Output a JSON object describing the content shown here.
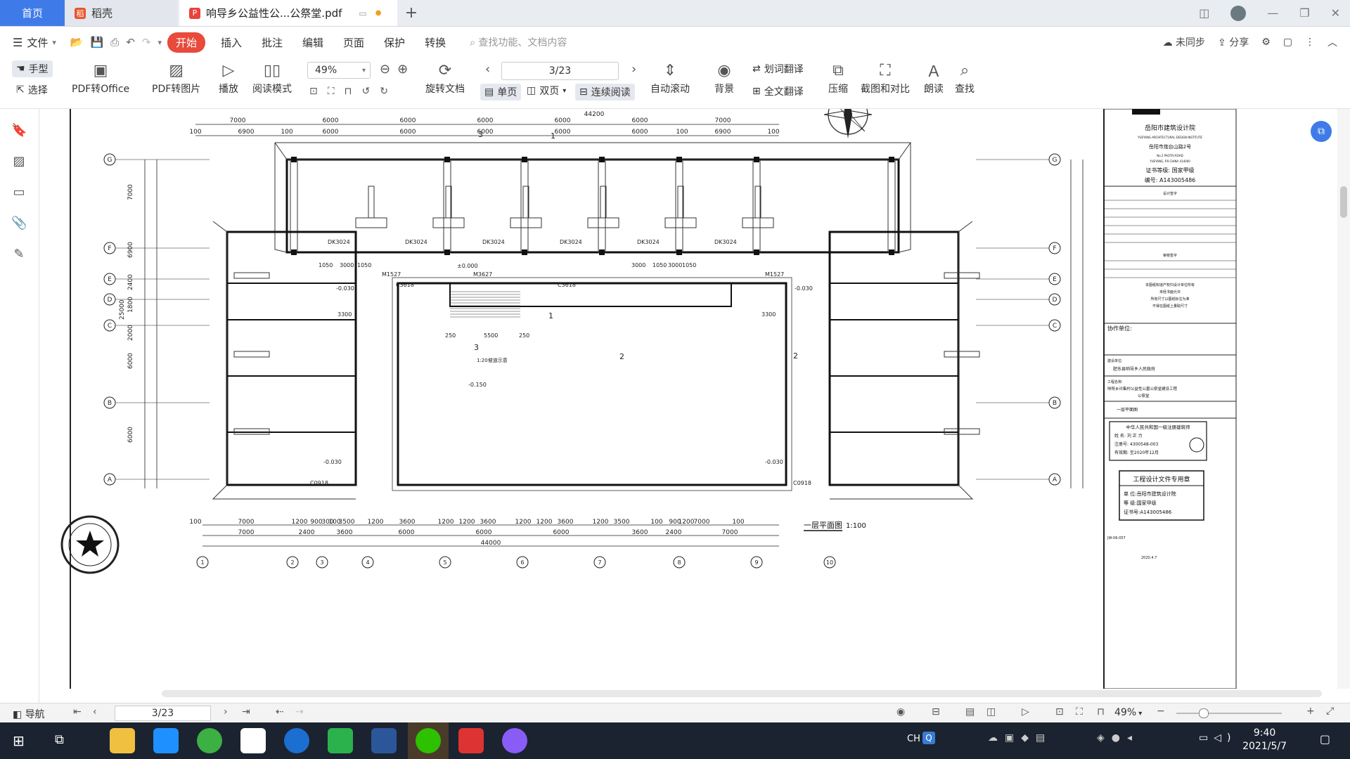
{
  "tabs": {
    "home": "首页",
    "daoke": "稻壳",
    "doc": "响导乡公益性公...公祭堂.pdf"
  },
  "menu": {
    "file": "文件",
    "start": "开始",
    "items": [
      "插入",
      "批注",
      "编辑",
      "页面",
      "保护",
      "转换"
    ],
    "search_placeholder": "查找功能、文档内容",
    "sync": "未同步",
    "share": "分享"
  },
  "toolbar": {
    "hand": "手型",
    "select": "选择",
    "pdf_to_office": "PDF转Office",
    "pdf_to_image": "PDF转图片",
    "play": "播放",
    "read_mode": "阅读模式",
    "zoom": "49%",
    "page": "3/23",
    "rotate": "旋转文档",
    "single": "单页",
    "double": "双页",
    "continuous": "连续阅读",
    "autoscroll": "自动滚动",
    "background": "背景",
    "word_translate": "划词翻译",
    "full_translate": "全文翻译",
    "compress": "压缩",
    "screenshot_compare": "截图和对比",
    "read_aloud": "朗读",
    "find": "查找"
  },
  "drawing": {
    "top_dims_1": [
      "7000",
      "6000",
      "6000",
      "6000",
      "6000",
      "6000",
      "7000"
    ],
    "top_dims_2": [
      "100",
      "6900",
      "100",
      "6000",
      "6000",
      "6000",
      "6000",
      "6000",
      "100",
      "6900",
      "100"
    ],
    "top_total": "44200",
    "bottom_dims_1": [
      "100",
      "7000",
      "1200",
      "900",
      "300",
      "100",
      "3500",
      "1200",
      "3600",
      "1200",
      "1200",
      "3600",
      "1200",
      "1200",
      "3600",
      "1200",
      "3500",
      "100",
      "900",
      "1200",
      "7000",
      "100"
    ],
    "bottom_dims_2": [
      "7000",
      "2400",
      "3600",
      "6000",
      "6000",
      "6000",
      "3600",
      "2400",
      "7000"
    ],
    "bottom_total": "44000",
    "axis_left": [
      "G",
      "F",
      "E",
      "D",
      "C",
      "B",
      "A"
    ],
    "axis_right": [
      "G",
      "F",
      "E",
      "D",
      "C",
      "B",
      "A"
    ],
    "axis_bottom": [
      "1",
      "2",
      "3",
      "4",
      "5",
      "6",
      "7",
      "8",
      "9",
      "10"
    ],
    "left_dims": [
      "7000",
      "6900",
      "2400",
      "1800",
      "2000",
      "25000",
      "6000",
      "6000"
    ],
    "room_labels": [
      "DK3024",
      "DK3024",
      "DK3024",
      "DK3024",
      "DK3024",
      "DK3024"
    ],
    "door_labels": [
      "M1527",
      "M3627",
      "M1527",
      "C3618",
      "C3618",
      "C0918",
      "C0918"
    ],
    "elev_labels": [
      "±0.000",
      "-0.030",
      "-0.030",
      "-0.150",
      "-0.030",
      "-0.030"
    ],
    "mid_dims": [
      "1050",
      "3000",
      "1050",
      "3000",
      "1050",
      "3000",
      "1050",
      "5500",
      "250",
      "250",
      "3300",
      "3300"
    ],
    "section_marks": [
      "3",
      "1",
      "1",
      "3",
      "2",
      "2"
    ],
    "hall_note": "1:20坡道示意",
    "plan_title": "一层平面图",
    "plan_scale": "1:100",
    "north": "N"
  },
  "titleblock": {
    "institute": "岳阳市建筑设计院",
    "institute_en": "YUEYANG ARCHITECTURAL DESIGN INSTITUTE",
    "address": "岳阳市炮台山路2号",
    "address_en": "No.2 PAOTAI ROAD",
    "city_en": "YUEYANG, P.R.CHINA 414000",
    "cert_level": "证书等级: 国家甲级",
    "cert_no": "编号: A143005486",
    "design_sign": "设计签字",
    "review_sign": "审核签字",
    "notes": [
      "本图纸知道产权归设计单位所有",
      "未经书面允许",
      "所有尺寸以图纸标注为准",
      "不得在图纸上量取尺寸"
    ],
    "collab_unit": "协作单位:",
    "client_label": "建设单位:",
    "client": "肥东县响导乡人民政府",
    "project_label": "工程名称:",
    "project": "响导乡许集村公益性公墓公祭堂建设工程",
    "project_sub": "公祭堂",
    "drawing_name": "一层平面图",
    "registered": "中华人民共和国一级注册建筑师",
    "reg_name": "姓 名: 刘 正 力",
    "reg_no": "注册号: 4300548-003",
    "reg_valid": "有效期: 至2020年12月",
    "seal_title": "工程设计文件专用章",
    "seal_unit": "单 位:岳阳市建筑设计院",
    "seal_level": "等 级:国家甲级",
    "seal_cert": "证书号:A143005486",
    "date": "2020.4.7",
    "drawing_no": "JW-06-057"
  },
  "status": {
    "nav": "导航",
    "page": "3/23",
    "zoom": "49%"
  },
  "clock": {
    "time": "9:40",
    "date": "2021/5/7"
  },
  "taskbar": {
    "ime": "CH"
  },
  "colors": {
    "accent": "#3f7be8",
    "start_button": "#e84a3c",
    "taskbar": "#1b2330"
  }
}
